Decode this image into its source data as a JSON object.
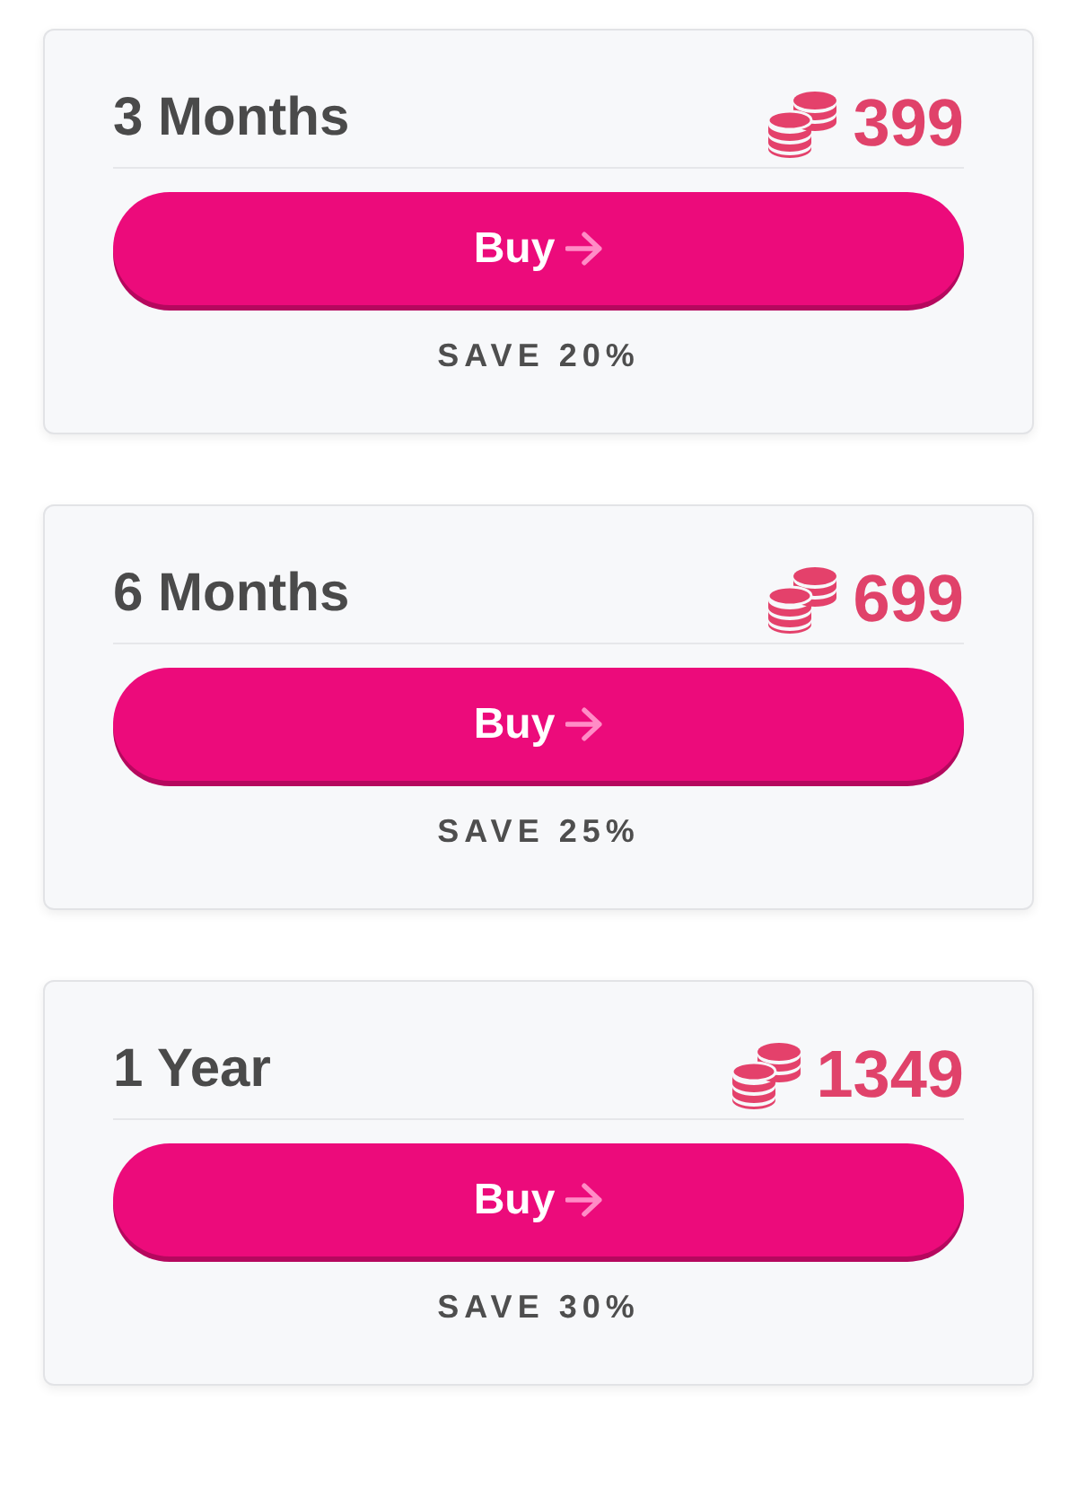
{
  "plans": [
    {
      "title": "3 Months",
      "price": "399",
      "button": {
        "label": "Buy"
      },
      "savings": "SAVE 20%"
    },
    {
      "title": "6 Months",
      "price": "699",
      "button": {
        "label": "Buy"
      },
      "savings": "SAVE 25%"
    },
    {
      "title": "1 Year",
      "price": "1349",
      "button": {
        "label": "Buy"
      },
      "savings": "SAVE 30%"
    }
  ]
}
